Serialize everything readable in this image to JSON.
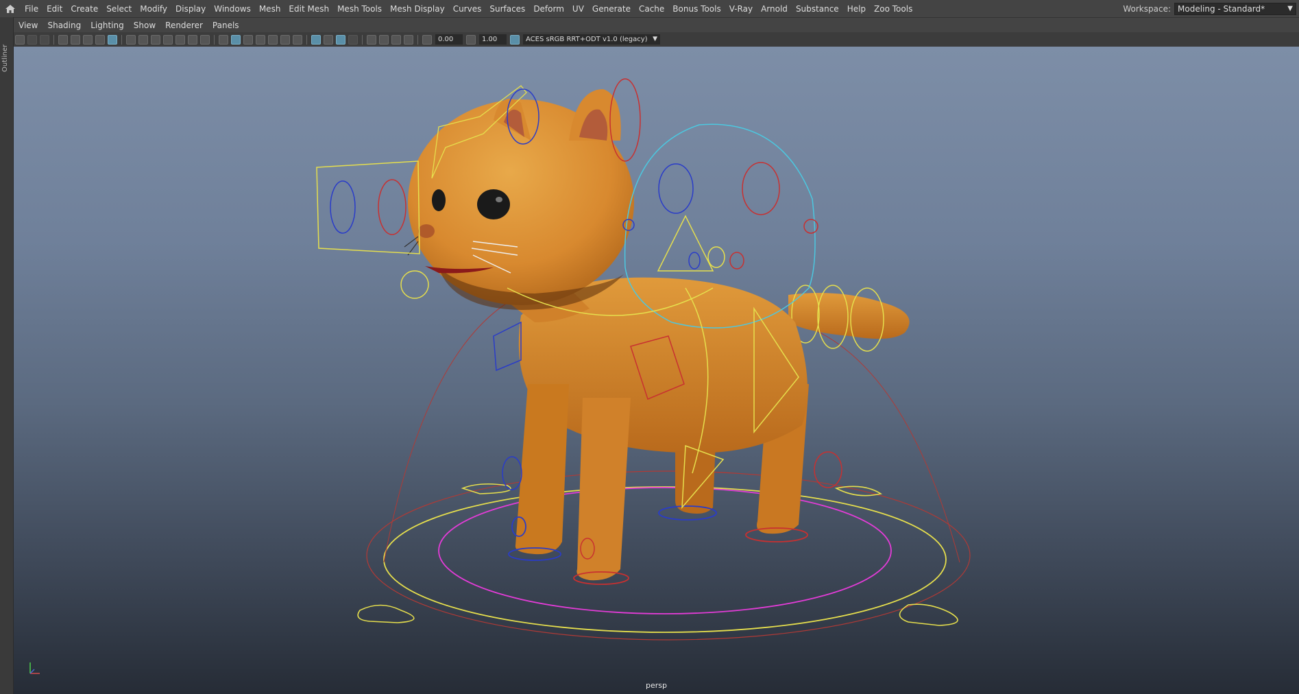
{
  "menubar": {
    "items": [
      "File",
      "Edit",
      "Create",
      "Select",
      "Modify",
      "Display",
      "Windows",
      "Mesh",
      "Edit Mesh",
      "Mesh Tools",
      "Mesh Display",
      "Curves",
      "Surfaces",
      "Deform",
      "UV",
      "Generate",
      "Cache",
      "Bonus Tools",
      "V-Ray",
      "Arnold",
      "Substance",
      "Help",
      "Zoo Tools"
    ],
    "workspace_label": "Workspace:",
    "workspace_value": "Modeling - Standard*"
  },
  "outliner": {
    "label": "Outliner"
  },
  "panel_menu": {
    "items": [
      "View",
      "Shading",
      "Lighting",
      "Show",
      "Renderer",
      "Panels"
    ]
  },
  "toolbar": {
    "exposure": "0.00",
    "gamma": "1.00",
    "color_space": "ACES sRGB RRT+ODT v1.0 (legacy)"
  },
  "viewport": {
    "camera": "persp"
  },
  "colors": {
    "menubar_bg": "#444444",
    "accent": "#5a8fa8",
    "cat_body": "#d8892f"
  }
}
